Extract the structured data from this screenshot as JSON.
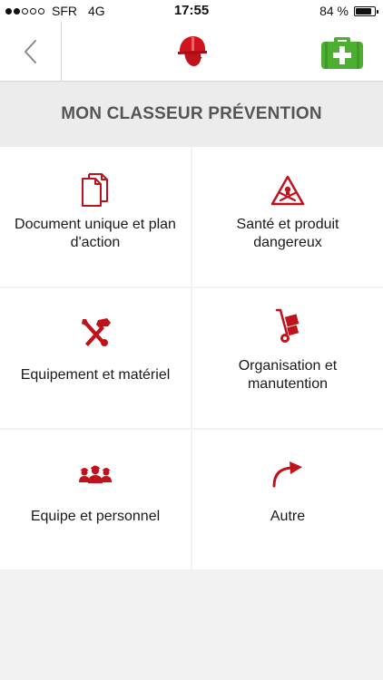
{
  "status_bar": {
    "carrier": "SFR",
    "network": "4G",
    "time": "17:55",
    "battery_text": "84 %",
    "battery_level": 0.84,
    "signal_bars_filled": 2,
    "signal_bars_total": 5
  },
  "navbar": {
    "back_icon": "chevron-left-icon",
    "logo_icon": "helmet-head-logo-icon",
    "firstaid_icon": "first-aid-kit-icon"
  },
  "header": {
    "title": "MON CLASSEUR PRÉVENTION"
  },
  "colors": {
    "accent_red": "#c0121b",
    "firstaid_green": "#4caf32",
    "header_bg": "#ececec",
    "tile_bg": "#ffffff"
  },
  "tiles": [
    {
      "label_line1": "Document unique et plan",
      "label_line2": "d'action",
      "icon": "documents-icon"
    },
    {
      "label_line1": "Santé et produit",
      "label_line2": "dangereux",
      "icon": "hazard-warning-icon"
    },
    {
      "label_line1": "Equipement et matériel",
      "label_line2": "",
      "icon": "tools-icon"
    },
    {
      "label_line1": "Organisation et",
      "label_line2": "manutention",
      "icon": "hand-truck-icon"
    },
    {
      "label_line1": "Equipe et personnel",
      "label_line2": "",
      "icon": "team-icon"
    },
    {
      "label_line1": "Autre",
      "label_line2": "",
      "icon": "curved-arrow-icon"
    }
  ]
}
